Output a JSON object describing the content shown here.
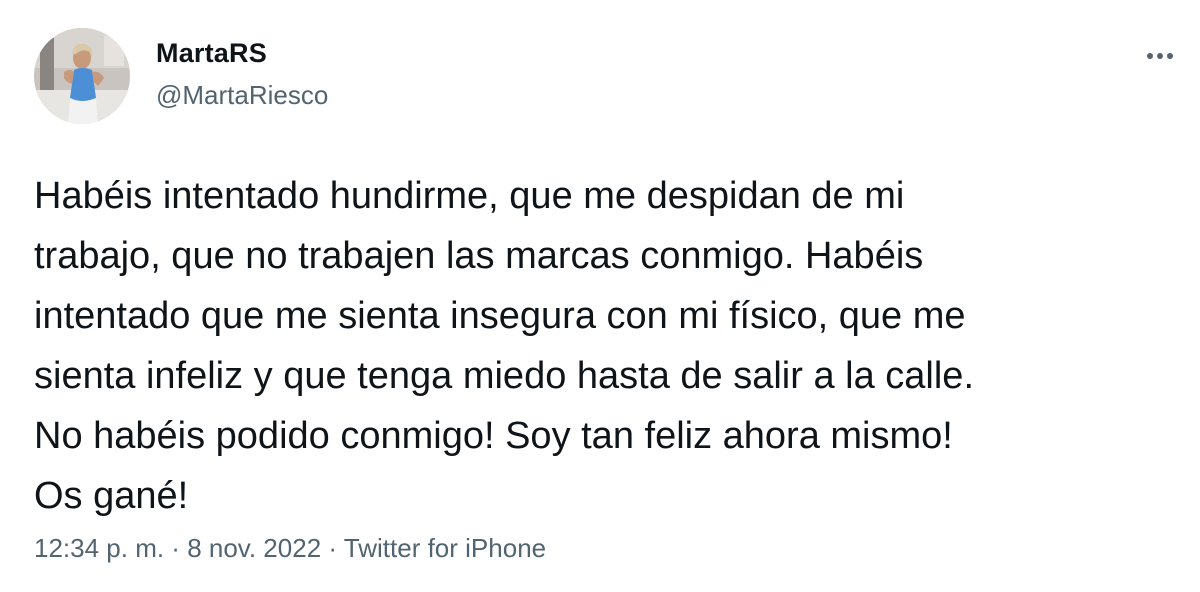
{
  "author": {
    "display_name": "MartaRS",
    "handle": "@MartaRiesco",
    "avatar_icon": "profile-photo"
  },
  "more_icon": "more-horizontal-icon",
  "tweet": {
    "text": "Habéis intentado hundirme, que me despidan de mi\ntrabajo, que no trabajen las marcas conmigo. Habéis\nintentado que me sienta insegura con mi físico, que me\nsienta infeliz y que tenga miedo hasta de salir a la calle.\nNo habéis podido conmigo! Soy tan feliz ahora mismo!\nOs gané!"
  },
  "meta": {
    "time": "12:34 p. m.",
    "separator": " · ",
    "date": "8 nov. 2022",
    "source": "Twitter for iPhone"
  },
  "colors": {
    "text_primary": "#0f1419",
    "text_secondary": "#536471",
    "background": "#ffffff"
  }
}
